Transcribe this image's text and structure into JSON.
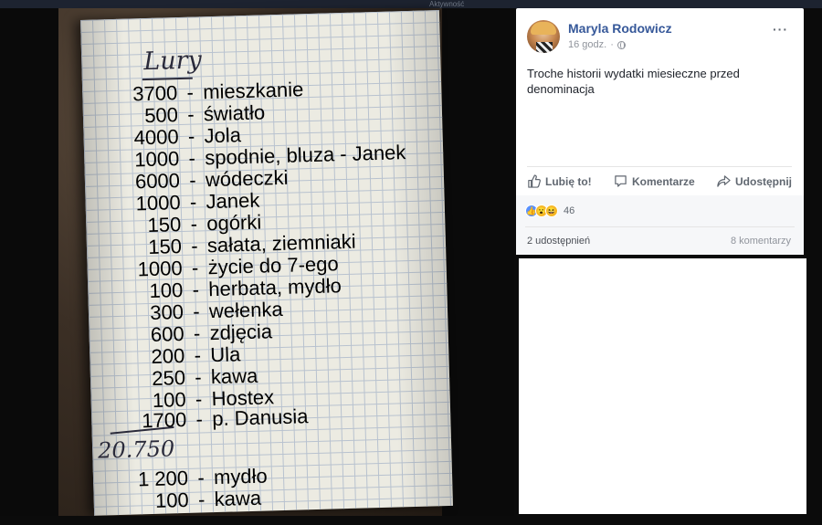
{
  "top_strip": {
    "text": "Aktywność"
  },
  "notebook": {
    "title": "Lury",
    "rows": [
      {
        "amount": "3700",
        "item": "mieszkanie"
      },
      {
        "amount": "500",
        "item": "światło"
      },
      {
        "amount": "4000",
        "item": "Jola"
      },
      {
        "amount": "1000",
        "item": "spodnie, bluza - Janek"
      },
      {
        "amount": "6000",
        "item": "wódeczki"
      },
      {
        "amount": "1000",
        "item": "Janek"
      },
      {
        "amount": "150",
        "item": "ogórki"
      },
      {
        "amount": "150",
        "item": "sałata, ziemniaki"
      },
      {
        "amount": "1000",
        "item": "życie do 7-ego"
      },
      {
        "amount": "100",
        "item": "herbata, mydło"
      },
      {
        "amount": "300",
        "item": "wełenka"
      },
      {
        "amount": "600",
        "item": "zdjęcia"
      },
      {
        "amount": "200",
        "item": "Ula"
      },
      {
        "amount": "250",
        "item": "kawa"
      },
      {
        "amount": "100",
        "item": "Hostex"
      },
      {
        "amount": "1700",
        "item": "p. Danusia"
      }
    ],
    "total": "20.750",
    "after_rows": [
      {
        "amount": "1 200",
        "item": "mydło"
      },
      {
        "amount": "100",
        "item": "kawa"
      }
    ]
  },
  "post": {
    "author": "Maryla Rodowicz",
    "time": "16 godz.",
    "separator": "·",
    "more": "···",
    "text": "Troche historii wydatki miesieczne przed denominacja",
    "actions": {
      "like": "Lubię to!",
      "comment": "Komentarze",
      "share": "Udostępnij"
    },
    "reaction_count": "46",
    "shares": "2 udostępnień",
    "comments": "8 komentarzy"
  }
}
